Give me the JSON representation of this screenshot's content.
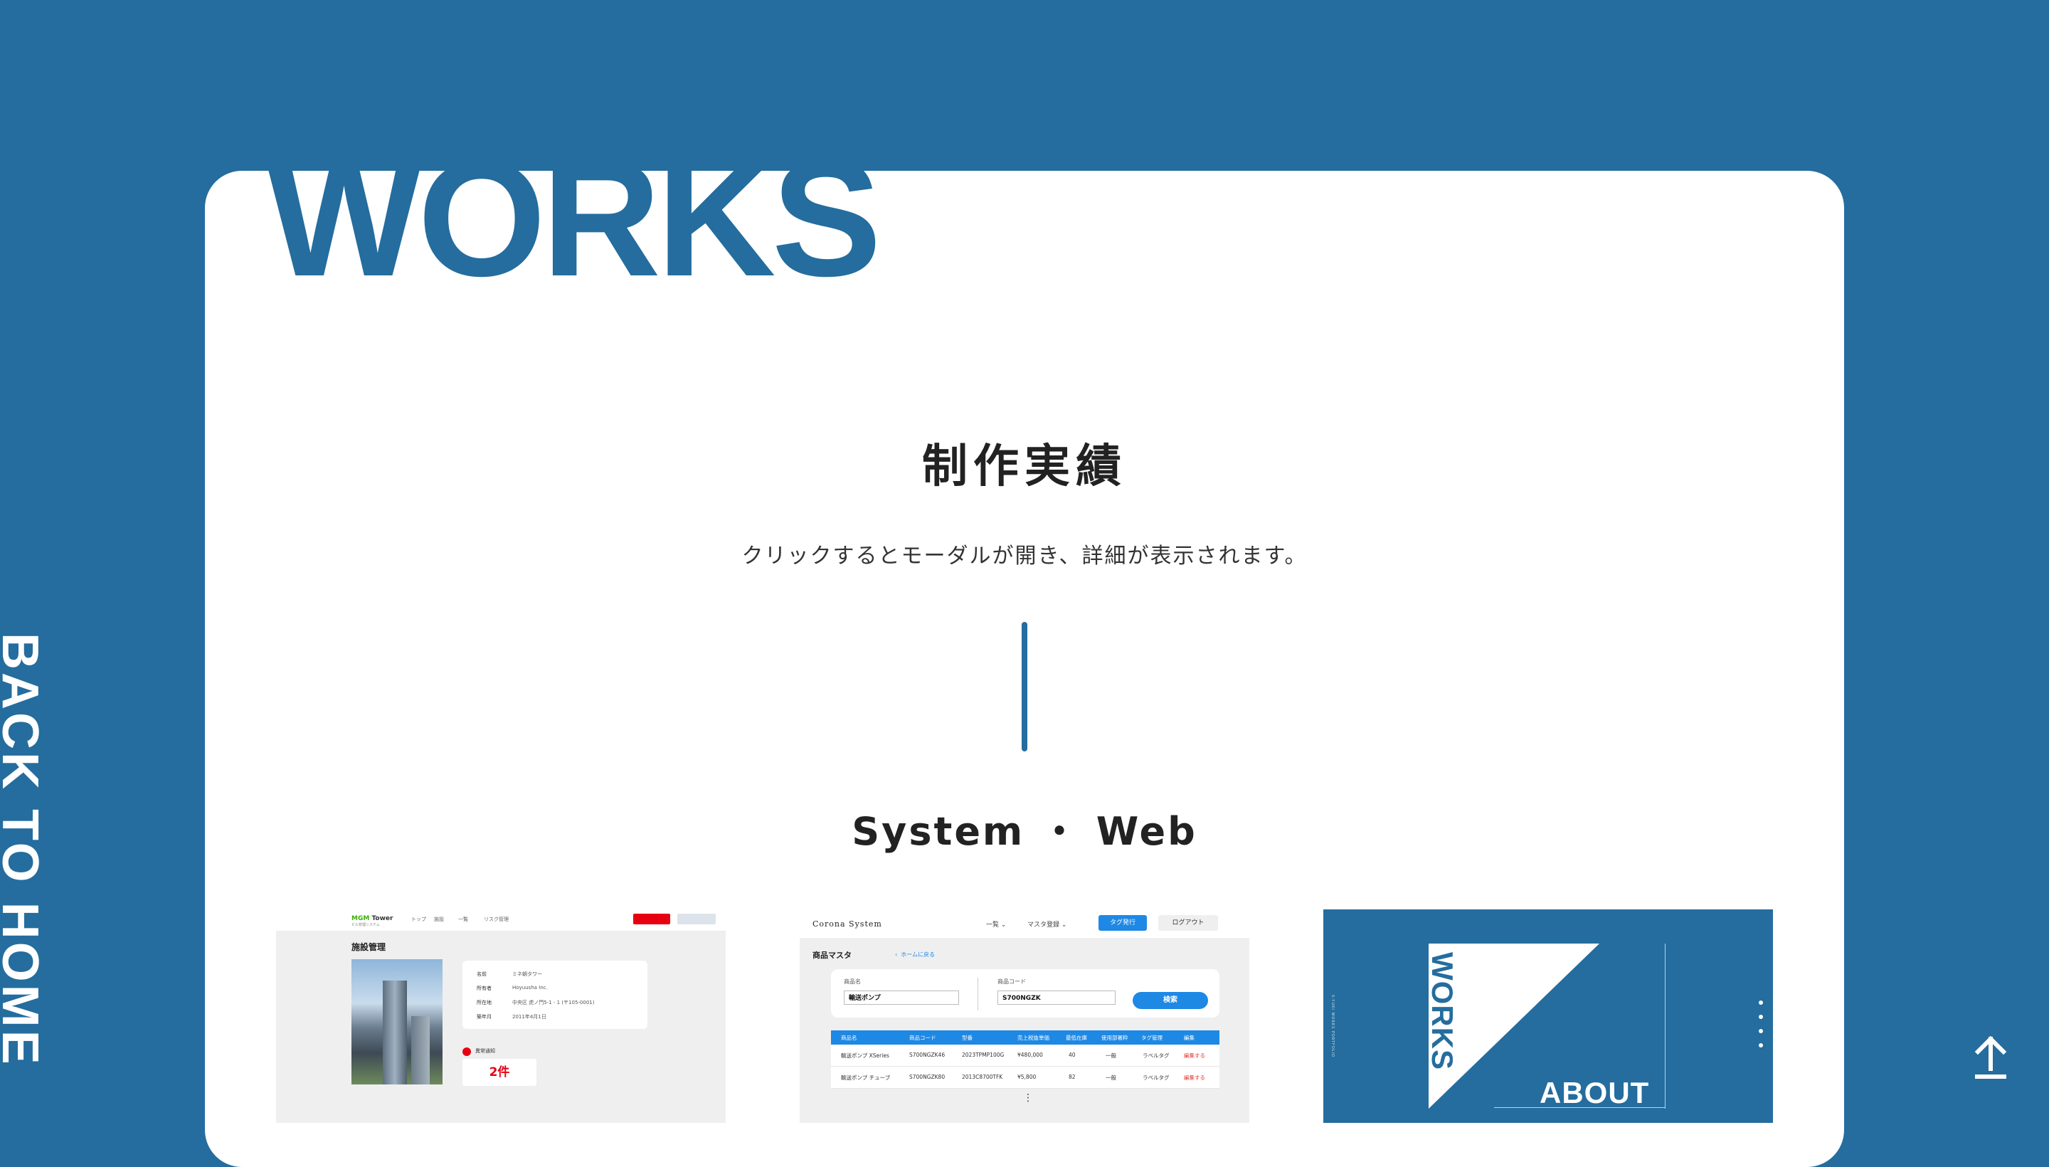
{
  "nav": {
    "back_home": "BACK TO HOME"
  },
  "section": {
    "title_en": "WORKS",
    "title_jp": "制作実績",
    "description": "クリックするとモーダルが開き、詳細が表示されます。",
    "category": "System ・ Web"
  },
  "works": [
    {
      "name": "facility-management",
      "logo_accent": "MGM",
      "logo_rest": " Tower",
      "logo_sub": "ビル管理システム",
      "nav": [
        "トップ",
        "施設",
        "一覧",
        "リスク管理"
      ],
      "page_title": "施設管理",
      "info_rows": [
        {
          "label": "名前",
          "value": "ミネ朝タワー"
        },
        {
          "label": "所有者",
          "value": "Hoyuusha Inc."
        },
        {
          "label": "所在地",
          "value": "中央区 虎ノ門5-1 - 1 (〒105-0001)"
        },
        {
          "label": "築年月",
          "value": "2011年4月1日"
        }
      ],
      "alert_label": "異常通知",
      "alert_count": "2件"
    },
    {
      "name": "corona-system",
      "logo": "Corona System",
      "nav": [
        "一覧",
        "マスタ登録"
      ],
      "buttons": {
        "tag": "タグ発行",
        "logout": "ログアウト"
      },
      "page_title": "商品マスタ",
      "back_link": "ホームに戻る",
      "form": {
        "name_label": "商品名",
        "name_value": "輸送ポンプ",
        "code_label": "商品コード",
        "code_value": "S700NGZK",
        "search_button": "検索"
      },
      "table": {
        "headers": [
          "商品名",
          "商品コード",
          "型番",
          "売上税抜単価",
          "最低在庫",
          "使用部署粋",
          "タグ管理",
          "編集"
        ],
        "rows": [
          [
            "輸送ポンプ XSeries",
            "S700NGZK46",
            "2023TPMP100G",
            "¥480,000",
            "40",
            "一般",
            "ラベルタグ",
            "編集する"
          ],
          [
            "輸送ポンプ チューブ",
            "S700NGZK80",
            "2013C8700TFK",
            "¥5,800",
            "82",
            "一般",
            "ラベルタグ",
            "編集する"
          ]
        ],
        "more": "⋮"
      }
    },
    {
      "name": "portfolio-site",
      "vertical_text": "S-YUKI WORKS PORTFOLIO",
      "title": "WORKS",
      "subtitle": "ABOUT"
    }
  ],
  "colors": {
    "brand_blue": "#246d9e",
    "white": "#ffffff",
    "text": "#222222",
    "system_blue": "#1e88e5",
    "alert_red": "#e60012"
  },
  "icons": {
    "to_top": "arrow-up-bar-icon"
  }
}
